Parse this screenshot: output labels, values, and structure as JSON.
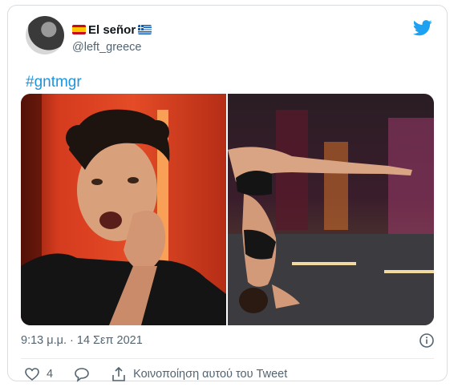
{
  "user": {
    "name": "El señor",
    "handle": "@left_greece",
    "flag_left": "spain-flag-icon",
    "flag_right": "greece-flag-icon"
  },
  "brand_icon": "twitter-bird-icon",
  "tweet": {
    "hashtag": "#gntmgr",
    "timestamp": "9:13 μ.μ. · 14 Σεπ 2021"
  },
  "actions": {
    "like_count": "4",
    "share_label": "Κοινοποίηση αυτού του Tweet"
  },
  "colors": {
    "link": "#1b95e0",
    "twitter_blue": "#1da1f2",
    "secondary_text": "#536471"
  }
}
